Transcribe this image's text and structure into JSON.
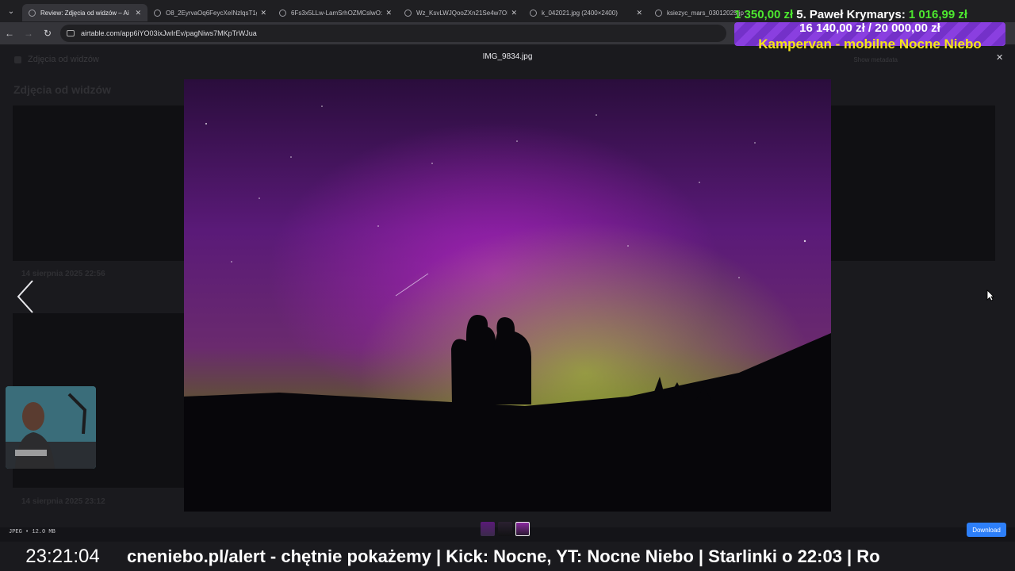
{
  "browser": {
    "tabs": [
      {
        "label": "Review: Zdjęcia od widzów – Ai",
        "active": true
      },
      {
        "label": "O8_2EyrvaOq6FeycXeINzlqsT1g",
        "active": false
      },
      {
        "label": "6Fs3x5LLw-LamSrhOZMCslwO:",
        "active": false
      },
      {
        "label": "Wz_KsvLWJQooZXn21Se4w7OI",
        "active": false
      },
      {
        "label": "k_042021.jpg (2400×2400)",
        "active": false
      },
      {
        "label": "ksiezyc_mars_03012025.jp",
        "active": false
      }
    ],
    "url": "airtable.com/app6iYO03ixJwIrEv/pagNiws7MKpTrWJua"
  },
  "page": {
    "header": "Zdjęcia od widzów",
    "header_right": "Show metadata",
    "title": "Zdjęcia od widzów",
    "dates": [
      "14 sierpnia 2025 22:56",
      "14 sierpnia 2025 23:12"
    ]
  },
  "modal": {
    "title": "IMG_9834.jpg",
    "file_meta": "JPEG • 12.0 MB",
    "download_label": "Download",
    "close_icon": "close-icon",
    "prev_icon": "chevron-left-icon"
  },
  "overlay": {
    "donation_amount_prev": "1 350,00 zł",
    "donation_rank": "5. Paweł Krymarys:",
    "donation_amount": "1 016,99 zł",
    "goal_progress": "16 140,00 zł / 20 000,00 zł",
    "goal_fraction": 0.807,
    "goal_title": "Kampervan - mobilne Nocne Niebo",
    "clock": "23:21:04",
    "ticker": "cneniebo.pl/alert - chętnie pokażemy  |  Kick: Nocne, YT: Nocne Niebo  |  Starlinki o 22:03  |  Ro"
  },
  "colors": {
    "accent_blue": "#2d7ff9",
    "donation_green": "#4de82f",
    "goal_purple": "#8a3fe0",
    "goal_yellow": "#f5e51a"
  }
}
